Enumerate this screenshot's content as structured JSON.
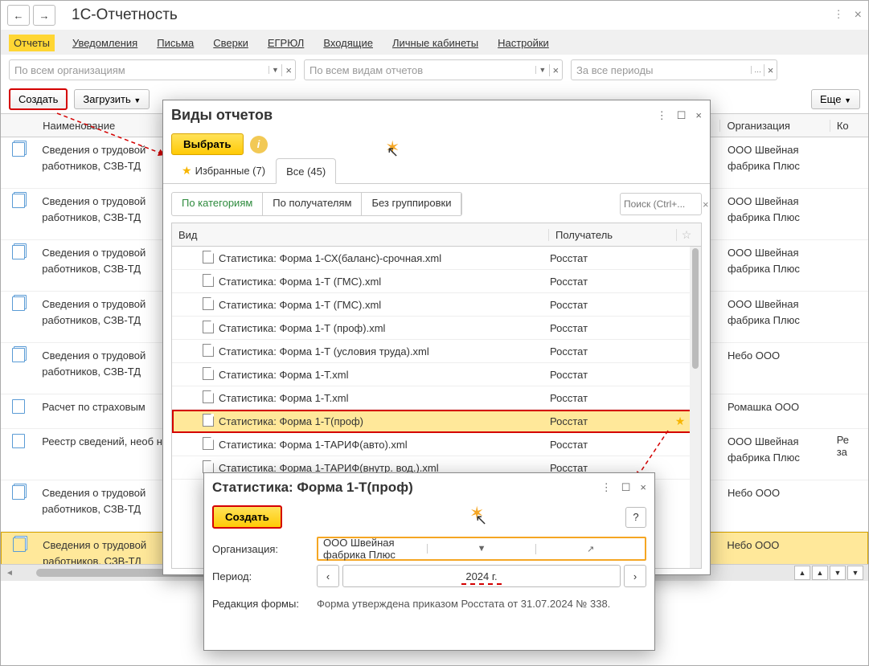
{
  "title": "1С-Отчетность",
  "tabs": [
    "Отчеты",
    "Уведомления",
    "Письма",
    "Сверки",
    "ЕГРЮЛ",
    "Входящие",
    "Личные кабинеты",
    "Настройки"
  ],
  "filters": {
    "org": "По всем организациям",
    "type": "По всем видам отчетов",
    "period": "За все периоды"
  },
  "buttons": {
    "create": "Создать",
    "load": "Загрузить",
    "more": "Еще"
  },
  "cols": {
    "name": "Наименование",
    "org": "Организация",
    "ko": "Ко"
  },
  "rows": [
    {
      "name": "Сведения о трудовой . работников, СЗВ-ТД",
      "org": "ООО Швейная фабрика Плюс",
      "icon": "dup"
    },
    {
      "name": "Сведения о трудовой . работников, СЗВ-ТД",
      "org": "ООО Швейная фабрика Плюс",
      "icon": "dup"
    },
    {
      "name": "Сведения о трудовой . работников, СЗВ-ТД",
      "org": "ООО Швейная фабрика Плюс",
      "icon": "dup"
    },
    {
      "name": "Сведения о трудовой . работников, СЗВ-ТД",
      "org": "ООО Швейная фабрика Плюс",
      "icon": "dup"
    },
    {
      "name": "Сведения о трудовой . работников, СЗВ-ТД",
      "org": "Небо ООО",
      "icon": "dup"
    },
    {
      "name": "Расчет по страховым",
      "org": "Ромашка ООО",
      "icon": "single",
      "short": true
    },
    {
      "name": "Реестр сведений, необ назначения и выплаты",
      "org": "ООО Швейная фабрика Плюс",
      "icon": "single",
      "ko": "Ре за"
    },
    {
      "name": "Сведения о трудовой . работников, СЗВ-ТД",
      "org": "Небо ООО",
      "icon": "dup"
    },
    {
      "name": "Сведения о трудовой . работников, СЗВ-ТД",
      "org": "Небо ООО",
      "icon": "dup",
      "sel": true
    }
  ],
  "modal1": {
    "title": "Виды отчетов",
    "select": "Выбрать",
    "tab_fav": "Избранные (7)",
    "tab_all": "Все (45)",
    "filters": [
      "По категориям",
      "По получателям",
      "Без группировки"
    ],
    "search": "Поиск (Ctrl+...",
    "col_type": "Вид",
    "col_recv": "Получатель",
    "rows": [
      {
        "t": "Статистика: Форма 1-СХ(баланс)-срочная.xml",
        "r": "Росстат"
      },
      {
        "t": "Статистика: Форма 1-Т (ГМС).xml",
        "r": "Росстат"
      },
      {
        "t": "Статистика: Форма 1-Т (ГМС).xml",
        "r": "Росстат"
      },
      {
        "t": "Статистика: Форма 1-Т (проф).xml",
        "r": "Росстат"
      },
      {
        "t": "Статистика: Форма 1-Т (условия труда).xml",
        "r": "Росстат"
      },
      {
        "t": "Статистика: Форма 1-Т.xml",
        "r": "Росстат"
      },
      {
        "t": "Статистика: Форма 1-Т.xml",
        "r": "Росстат"
      },
      {
        "t": "Статистика: Форма 1-Т(проф)",
        "r": "Росстат",
        "hl": true,
        "star": true
      },
      {
        "t": "Статистика: Форма 1-ТАРИФ(авто).xml",
        "r": "Росстат"
      },
      {
        "t": "Статистика: Форма 1-ТАРИФ(внутр. вод.).xml",
        "r": "Росстат"
      }
    ]
  },
  "modal2": {
    "title": "Статистика: Форма 1-Т(проф)",
    "create": "Создать",
    "org_label": "Организация:",
    "org_value": "ООО Швейная фабрика Плюс",
    "period_label": "Период:",
    "period_value": "2024 г.",
    "red_label": "Редакция формы:",
    "red_value": "Форма утверждена приказом Росстата от 31.07.2024 № 338."
  }
}
